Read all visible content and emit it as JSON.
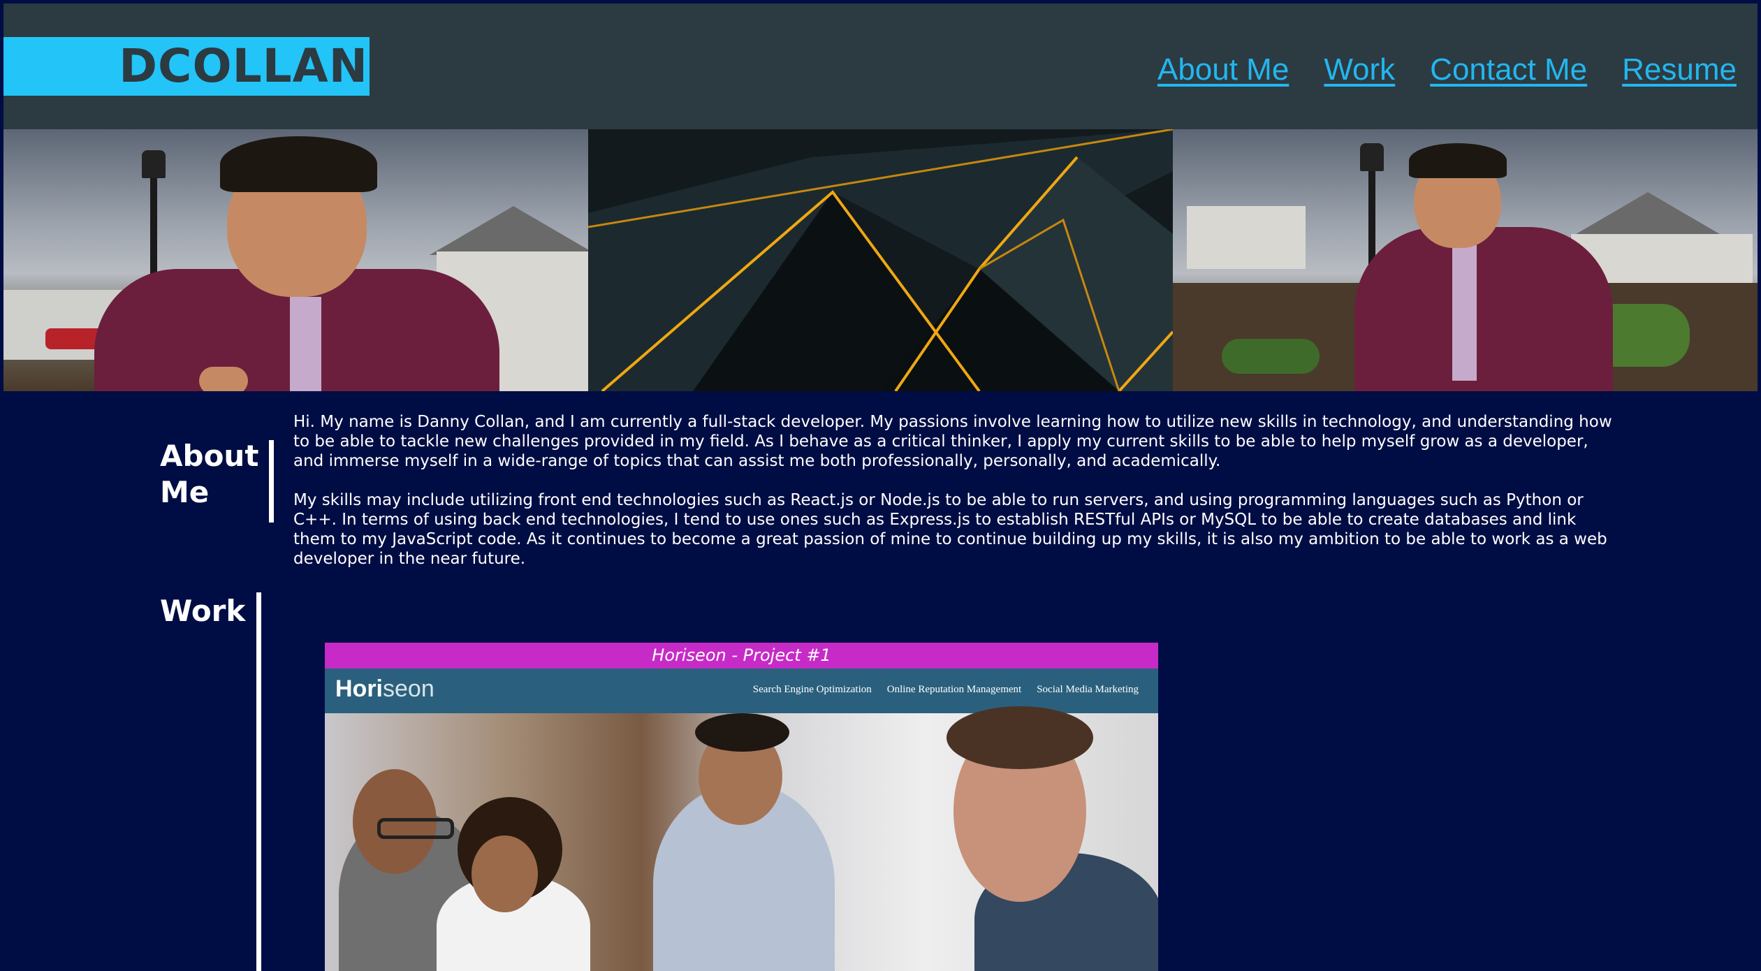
{
  "header": {
    "logo_text": "DCOLLAN",
    "nav": [
      {
        "label": "About Me"
      },
      {
        "label": "Work"
      },
      {
        "label": "Contact Me"
      },
      {
        "label": "Resume"
      }
    ]
  },
  "about": {
    "title": "About Me",
    "paragraphs": [
      "Hi. My name is Danny Collan, and I am currently a full-stack developer. My passions involve learning how to utilize new skills in technology, and understanding how to be able to tackle new challenges provided in my field. As I behave as a critical thinker, I apply my current skills to be able to help myself grow as a developer, and immerse myself in a wide-range of topics that can assist me both professionally, personally, and academically.",
      "My skills may include utilizing front end technologies such as React.js or Node.js to be able to run servers, and using programming languages such as Python or C++. In terms of using back end technologies, I tend to use ones such as Express.js to establish RESTful APIs or MySQL to be able to create databases and link them to my JavaScript code. As it continues to become a great passion of mine to continue building up my skills, it is also my ambition to be able to work as a web developer in the near future."
    ]
  },
  "work": {
    "title": "Work",
    "projects": [
      {
        "caption": "Horiseon - Project #1",
        "screenshot": {
          "logo_bold": "Hori",
          "logo_light": "seon",
          "nav": [
            "Search Engine Optimization",
            "Online Reputation Management",
            "Social Media Marketing"
          ]
        }
      }
    ]
  },
  "colors": {
    "background": "#000d44",
    "header": "#2c3a42",
    "accent": "#23c4f8",
    "caption": "#c72bc7"
  }
}
